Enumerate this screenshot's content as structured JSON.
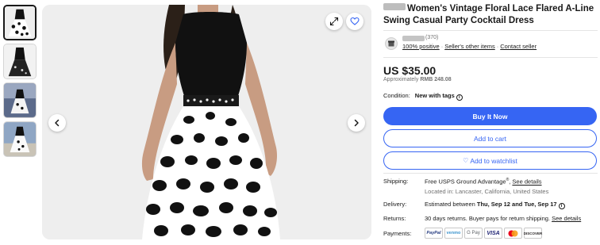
{
  "title": {
    "text": "Women's Vintage Floral Lace Flared A-Line Swing Casual Party Cocktail Dress"
  },
  "seller": {
    "feedback_count": "(370)",
    "positive": "100% positive",
    "other_items": "Seller's other items",
    "contact": "Contact seller"
  },
  "price": {
    "main": "US $35.00",
    "approx_label": "Approximately",
    "approx_value": "RMB 248.08"
  },
  "condition": {
    "label": "Condition:",
    "value": "New with tags"
  },
  "buttons": {
    "buy": "Buy It Now",
    "cart": "Add to cart",
    "watch": "Add to watchlist"
  },
  "shipping": {
    "label": "Shipping:",
    "value": "Free USPS Ground Advantage",
    "sup": "®",
    "link": "See details",
    "location": "Located in: Lancaster, California, United States"
  },
  "delivery": {
    "label": "Delivery:",
    "prefix": "Estimated between ",
    "dates": "Thu, Sep 12 and Tue, Sep 17"
  },
  "returns": {
    "label": "Returns:",
    "value": "30 days returns. Buyer pays for return shipping.",
    "link": "See details"
  },
  "payments": {
    "label": "Payments:",
    "methods": [
      "PayPal",
      "venmo",
      "G Pay",
      "VISA",
      "Mastercard",
      "DISCOVER"
    ]
  },
  "icons": {
    "prev": "chevron-left-icon",
    "next": "chevron-right-icon",
    "expand": "expand-icon",
    "favorite": "heart-icon",
    "info": "info-icon"
  },
  "colors": {
    "accent": "#3665f3",
    "text": "#191919",
    "muted": "#707070"
  }
}
